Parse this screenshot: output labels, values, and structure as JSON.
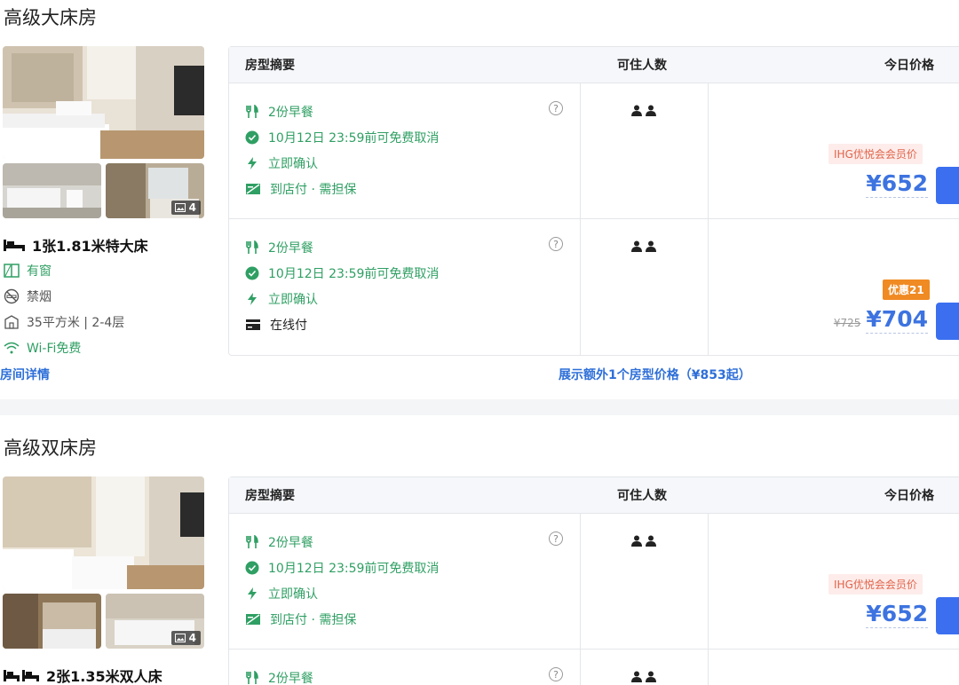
{
  "header": {
    "summary": "房型摘要",
    "occupancy": "可住人数",
    "price": "今日价格"
  },
  "rooms": [
    {
      "title": "高级大床房",
      "photo_count": "4",
      "bed": "1张1.81米特大床",
      "features": [
        "有窗",
        "禁烟",
        "35平方米 | 2-4层",
        "Wi-Fi免费"
      ],
      "details_link": "房间详情",
      "more_link": "展示额外1个房型价格（¥853起）",
      "rates": [
        {
          "perks": [
            "2份早餐",
            "10月12日 23:59前可免费取消",
            "立即确认",
            "到店付 · 需担保"
          ],
          "badge": "IHG优悦会会员价",
          "orig": "",
          "price": "¥652"
        },
        {
          "perks": [
            "2份早餐",
            "10月12日 23:59前可免费取消",
            "立即确认",
            "在线付"
          ],
          "badge": "优惠21",
          "orig": "¥725",
          "price": "¥704"
        }
      ]
    },
    {
      "title": "高级双床房",
      "photo_count": "4",
      "bed": "2张1.35米双人床",
      "rates": [
        {
          "perks": [
            "2份早餐",
            "10月12日 23:59前可免费取消",
            "立即确认",
            "到店付 · 需担保"
          ],
          "badge": "IHG优悦会会员价",
          "orig": "",
          "price": "¥652"
        },
        {
          "perks": [
            "2份早餐"
          ]
        }
      ]
    }
  ],
  "icons": [
    "fork-knife-icon",
    "check-circle-icon",
    "lightning-icon",
    "card-slash-icon",
    "card-icon",
    "bed-icon",
    "window-icon",
    "no-smoking-icon",
    "area-icon",
    "wifi-icon",
    "help-icon",
    "person-icon",
    "image-icon"
  ],
  "colors": {
    "green": "#2f9f63",
    "price_blue": "#3d73e0",
    "link_blue": "#2e6fd8",
    "deal_orange": "#f08a23",
    "ihg_text": "#e0644a",
    "ihg_bg": "#fdecea",
    "button_blue": "#3b6ff0"
  }
}
